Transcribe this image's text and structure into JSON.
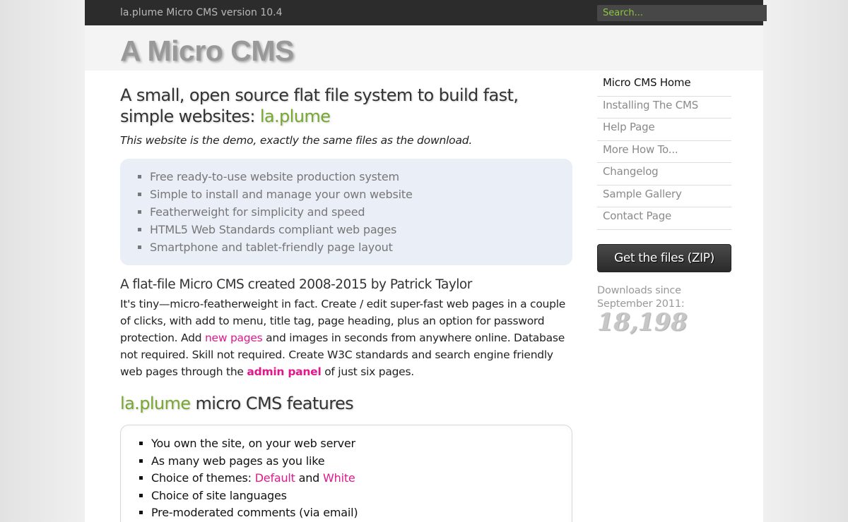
{
  "topbar": {
    "version": "la.plume Micro CMS version 10.4",
    "search_placeholder": "Search..."
  },
  "header": {
    "site_title": "A Micro CMS"
  },
  "main": {
    "headline_prefix": "A small, open source flat file system to build fast, simple websites: ",
    "headline_brand": "la.plume",
    "intro": "This website is the demo, exactly the same files as the download.",
    "highlights": [
      "Free ready-to-use website production system",
      "Simple to install and manage your own website",
      "Featherweight for simplicity and speed",
      "HTML5 Web Standards compliant web pages",
      "Smartphone and tablet-friendly page layout"
    ],
    "subhead": "A flat-file Micro CMS created 2008-2015 by Patrick Taylor",
    "para": {
      "part1": "It's tiny—micro-featherweight in fact. Create / edit super-fast web pages in a couple of clicks, with add to menu, title tag, page heading, plus an option for password protection. Add ",
      "link_new_pages": "new pages",
      "part2": " and images in seconds from anywhere online. Database not required. Skill not required. Create W3C standards and search engine friendly web pages through the ",
      "link_admin": "admin panel",
      "part3": " of just six pages."
    },
    "features_head_brand": "la.plume",
    "features_head_rest": " micro CMS features",
    "features": {
      "item1": "You own the site, on your web server",
      "item2": "As many web pages as you like",
      "item3_prefix": "Choice of themes: ",
      "theme_default": "Default",
      "item3_and": " and ",
      "theme_white": "White",
      "item4": "Choice of site languages",
      "item5": "Pre-moderated comments (via email)"
    }
  },
  "sidebar": {
    "nav": [
      "Micro CMS Home",
      "Installing The CMS",
      "Help Page",
      "More How To...",
      "Changelog",
      "Sample Gallery",
      "Contact Page"
    ],
    "zip_button": "Get the files (ZIP)",
    "downloads_label": "Downloads since September 2011:",
    "downloads_count": "18,198"
  },
  "colors": {
    "accent_green": "#78a832",
    "link_pink": "#e0188c",
    "topbar_bg": "#2c2c2c",
    "feature_box_bg": "#e9eef7"
  }
}
